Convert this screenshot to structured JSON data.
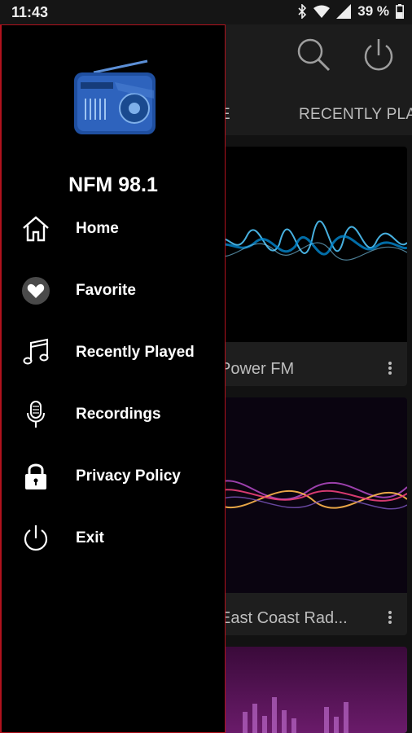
{
  "status": {
    "time": "11:43",
    "battery": "39 %"
  },
  "app": {
    "tabs": [
      {
        "label": "E"
      },
      {
        "label": "RECENTLY PLA"
      }
    ],
    "cards": [
      {
        "title": "Power FM"
      },
      {
        "title": "East Coast Rad..."
      },
      {
        "title": ""
      }
    ]
  },
  "drawer": {
    "station_name": "NFM 98.1",
    "menu": [
      {
        "label": "Home",
        "icon": "home-icon"
      },
      {
        "label": "Favorite",
        "icon": "heart-icon"
      },
      {
        "label": "Recently Played",
        "icon": "music-note-icon"
      },
      {
        "label": "Recordings",
        "icon": "microphone-icon"
      },
      {
        "label": "Privacy Policy",
        "icon": "lock-icon"
      },
      {
        "label": "Exit",
        "icon": "power-icon"
      }
    ]
  },
  "colors": {
    "drawer_border": "#b0121d",
    "background": "#000000"
  }
}
